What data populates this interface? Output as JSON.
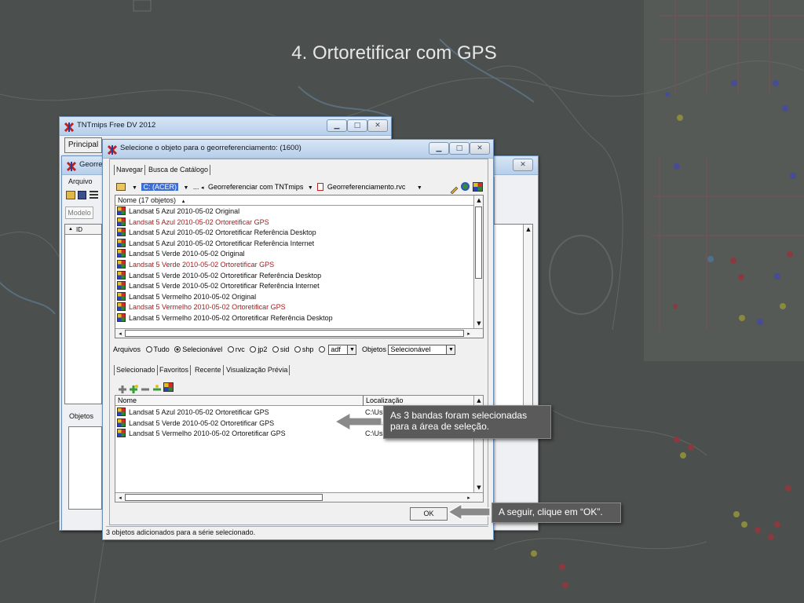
{
  "slide": {
    "title": "4. Ortoretificar com GPS"
  },
  "back_window": {
    "title": "TNTmips Free DV 2012",
    "menu_principal": "Principal"
  },
  "mid_window": {
    "title": "Georreferenciar",
    "menu_arquivo": "Arquivo",
    "label_modelo": "Modelo",
    "column_id": "ID",
    "label_objetos": "Objetos"
  },
  "dialog": {
    "title": "Selecione o objeto para o georreferenciamento: (1600)",
    "tabs": [
      "Navegar",
      "Busca de Catálogo"
    ],
    "path": {
      "drive": "C: (ACER)",
      "ellipsis": "...",
      "folder": "Georreferenciar com TNTmips",
      "file": "Georreferenciamento.rvc"
    },
    "list_header": "Nome  (17 objetos)",
    "items": [
      {
        "label": "Landsat 5 Azul 2010-05-02 Original",
        "selected": false
      },
      {
        "label": "Landsat 5 Azul 2010-05-02 Ortoretificar GPS",
        "selected": true
      },
      {
        "label": "Landsat 5 Azul 2010-05-02 Ortoretificar Referência Desktop",
        "selected": false
      },
      {
        "label": "Landsat 5 Azul 2010-05-02 Ortoretificar Referência Internet",
        "selected": false
      },
      {
        "label": "Landsat 5 Verde 2010-05-02 Original",
        "selected": false
      },
      {
        "label": "Landsat 5 Verde 2010-05-02 Ortoretificar GPS",
        "selected": true
      },
      {
        "label": "Landsat 5 Verde 2010-05-02 Ortoretificar Referência Desktop",
        "selected": false
      },
      {
        "label": "Landsat 5 Verde 2010-05-02 Ortoretificar Referência Internet",
        "selected": false
      },
      {
        "label": "Landsat 5 Vermelho 2010-05-02 Original",
        "selected": false
      },
      {
        "label": "Landsat 5 Vermelho 2010-05-02 Ortoretificar GPS",
        "selected": true
      },
      {
        "label": "Landsat 5 Vermelho 2010-05-02 Ortoretificar Referência Desktop",
        "selected": false
      }
    ],
    "filter": {
      "label_arquivos": "Arquivos",
      "opt_tudo": "Tudo",
      "opt_selecionavel": "Selecionável",
      "opt_rvc": "rvc",
      "opt_jp2": "jp2",
      "opt_sid": "sid",
      "opt_shp": "shp",
      "combo_ext": "adf",
      "label_objetos": "Objetos",
      "combo_objetos": "Selecionável"
    },
    "lower_tabs": [
      "Selecionado",
      "Favoritos",
      "Recente",
      "Visualização Prévia"
    ],
    "selected_headers": {
      "name": "Nome",
      "location": "Localização"
    },
    "selected_items": [
      {
        "label": "Landsat 5 Azul 2010-05-02 Ortoretificar GPS",
        "location": "C:\\Us"
      },
      {
        "label": "Landsat 5 Verde 2010-05-02 Ortoretificar GPS",
        "location": "C:\\Us"
      },
      {
        "label": "Landsat 5 Vermelho 2010-05-02 Ortoretificar GPS",
        "location": "C:\\Us"
      }
    ],
    "ok_label": "OK",
    "status": "3 objetos adicionados para a série selecionado."
  },
  "callouts": {
    "bands": "As 3 bandas foram selecionadas para a área de seleção.",
    "ok_hint": "A seguir, clique em “OK”."
  },
  "colors": {
    "selected_text": "#a61c1c",
    "drive_highlight": "#3b6fd6",
    "callout_bg": "#5a5a5a"
  }
}
